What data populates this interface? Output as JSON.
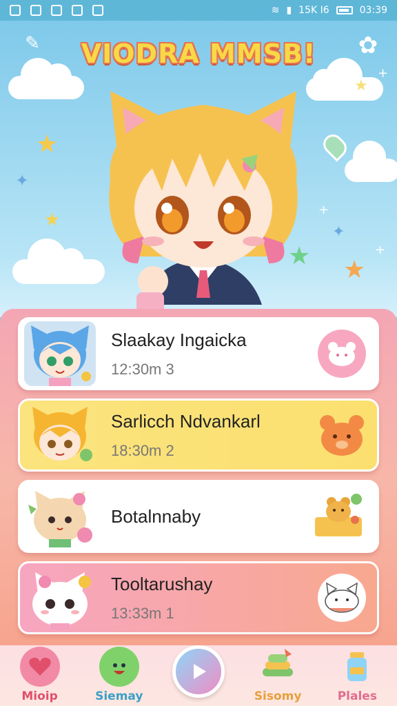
{
  "status_bar": {
    "left_icons": [
      "notification-icon",
      "mail-icon",
      "message-icon",
      "inbox-icon",
      "edit-icon"
    ],
    "signal_text": "15K I6",
    "time": "03:39"
  },
  "header": {
    "title": "VIODRA MMSB!",
    "left_icon": "wrench-icon",
    "right_icon": "settings-gear-icon"
  },
  "list": [
    {
      "title": "Slaakay Ingaicka",
      "time": "12:30m 3",
      "avatar": "blue-hair-cat-girl",
      "action_icon": "pink-bear-icon"
    },
    {
      "title": "Sarlicch Ndvankarl",
      "time": "18:30m 2",
      "avatar": "blonde-cat-boy",
      "action_icon": "orange-bear-icon"
    },
    {
      "title": "Botalnnaby",
      "time": "",
      "avatar": "cream-cat-with-flowers",
      "action_icon": "bear-in-box-icon"
    },
    {
      "title": "Tooltarushay",
      "time": "13:33m 1",
      "avatar": "white-cat-with-bow",
      "action_icon": "white-cat-face-icon"
    }
  ],
  "nav": [
    {
      "label": "Mioip",
      "icon": "heart-bubble-icon",
      "color": "#e0506b"
    },
    {
      "label": "Siemay",
      "icon": "green-bunny-icon",
      "color": "#3aa0c6"
    },
    {
      "label": "",
      "icon": "play-icon",
      "color": "#ffffff"
    },
    {
      "label": "Sisomy",
      "icon": "gift-stack-icon",
      "color": "#e6a03c"
    },
    {
      "label": "Plales",
      "icon": "jar-icon",
      "color": "#e06d8f"
    }
  ],
  "colors": {
    "accent": "#f7d948",
    "title_outline": "#e8724e",
    "sky": "#7fc9ea"
  }
}
